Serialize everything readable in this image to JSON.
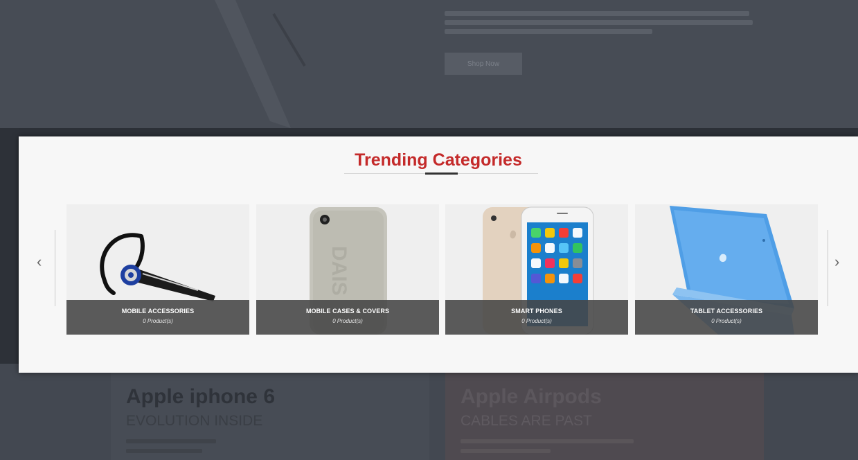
{
  "modal": {
    "title": "Trending Categories"
  },
  "carousel": {
    "prev_icon": "chevron-left-icon",
    "next_icon": "chevron-right-icon",
    "prev_glyph": "‹",
    "next_glyph": "›",
    "categories": [
      {
        "name": "MOBILE ACCESSORIES",
        "count": "0 Product(s)",
        "image": "bluetooth-headset"
      },
      {
        "name": "MOBILE CASES & COVERS",
        "count": "0 Product(s)",
        "image": "phone-case"
      },
      {
        "name": "SMART PHONES",
        "count": "0 Product(s)",
        "image": "iphone"
      },
      {
        "name": "TABLET ACCESSORIES",
        "count": "0 Product(s)",
        "image": "tablet-smart-cover"
      }
    ]
  },
  "background": {
    "hero_button": "Shop Now",
    "promos": [
      {
        "title": "Apple iphone 6",
        "subtitle": "EVOLUTION INSIDE"
      },
      {
        "title": "Apple Airpods",
        "subtitle": "CABLES ARE PAST"
      }
    ]
  },
  "colors": {
    "accent": "#c42a2a",
    "overlay": "#434851",
    "caption_bg": "#464646"
  }
}
